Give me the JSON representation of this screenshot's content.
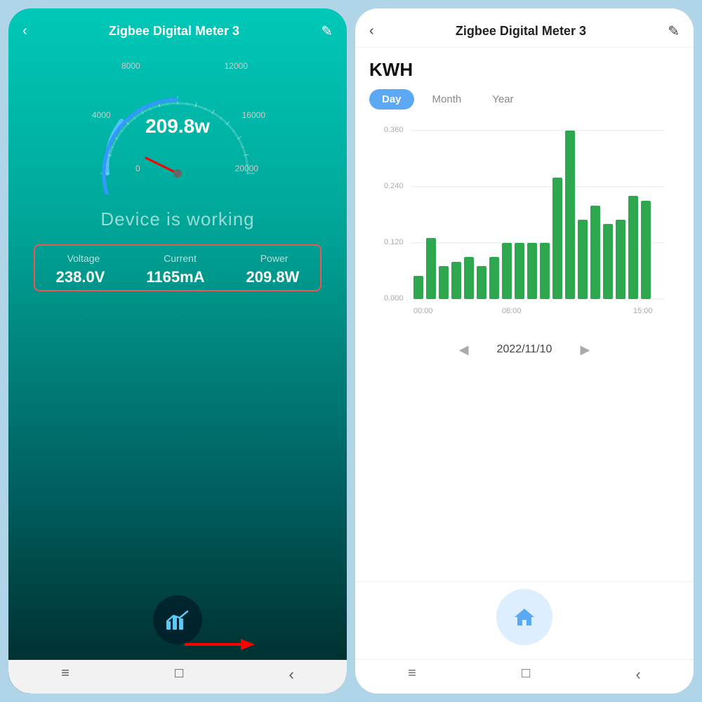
{
  "left": {
    "title": "Zigbee Digital Meter 3",
    "gauge": {
      "value": "209.8w",
      "labels": [
        "8000",
        "12000",
        "4000",
        "16000",
        "0",
        "20000"
      ]
    },
    "status": "Device is working",
    "stats": {
      "labels": [
        "Voltage",
        "Current",
        "Power"
      ],
      "values": [
        "238.0V",
        "1165mA",
        "209.8W"
      ]
    }
  },
  "right": {
    "title": "Zigbee Digital Meter 3",
    "kwh_label": "KWH",
    "tabs": [
      {
        "label": "Day",
        "active": true
      },
      {
        "label": "Month",
        "active": false
      },
      {
        "label": "Year",
        "active": false
      }
    ],
    "chart": {
      "y_labels": [
        "0.360",
        "0.240",
        "0.120",
        "0.000"
      ],
      "x_labels": [
        "00:00",
        "08:00",
        "15:00"
      ],
      "bars": [
        {
          "hour": 0,
          "value": 0.05
        },
        {
          "hour": 1,
          "value": 0.13
        },
        {
          "hour": 2,
          "value": 0.07
        },
        {
          "hour": 3,
          "value": 0.08
        },
        {
          "hour": 4,
          "value": 0.09
        },
        {
          "hour": 5,
          "value": 0.07
        },
        {
          "hour": 6,
          "value": 0.09
        },
        {
          "hour": 7,
          "value": 0.12
        },
        {
          "hour": 8,
          "value": 0.12
        },
        {
          "hour": 9,
          "value": 0.12
        },
        {
          "hour": 10,
          "value": 0.12
        },
        {
          "hour": 11,
          "value": 0.26
        },
        {
          "hour": 12,
          "value": 0.36
        },
        {
          "hour": 13,
          "value": 0.17
        },
        {
          "hour": 14,
          "value": 0.2
        },
        {
          "hour": 15,
          "value": 0.16
        },
        {
          "hour": 16,
          "value": 0.17
        },
        {
          "hour": 17,
          "value": 0.22
        },
        {
          "hour": 18,
          "value": 0.21
        }
      ]
    },
    "date": "2022/11/10",
    "colors": {
      "bar": "#2ea84f",
      "tab_active_bg": "#5ba8f5"
    }
  },
  "system_nav": {
    "menu": "≡",
    "home": "□",
    "back": "‹"
  }
}
